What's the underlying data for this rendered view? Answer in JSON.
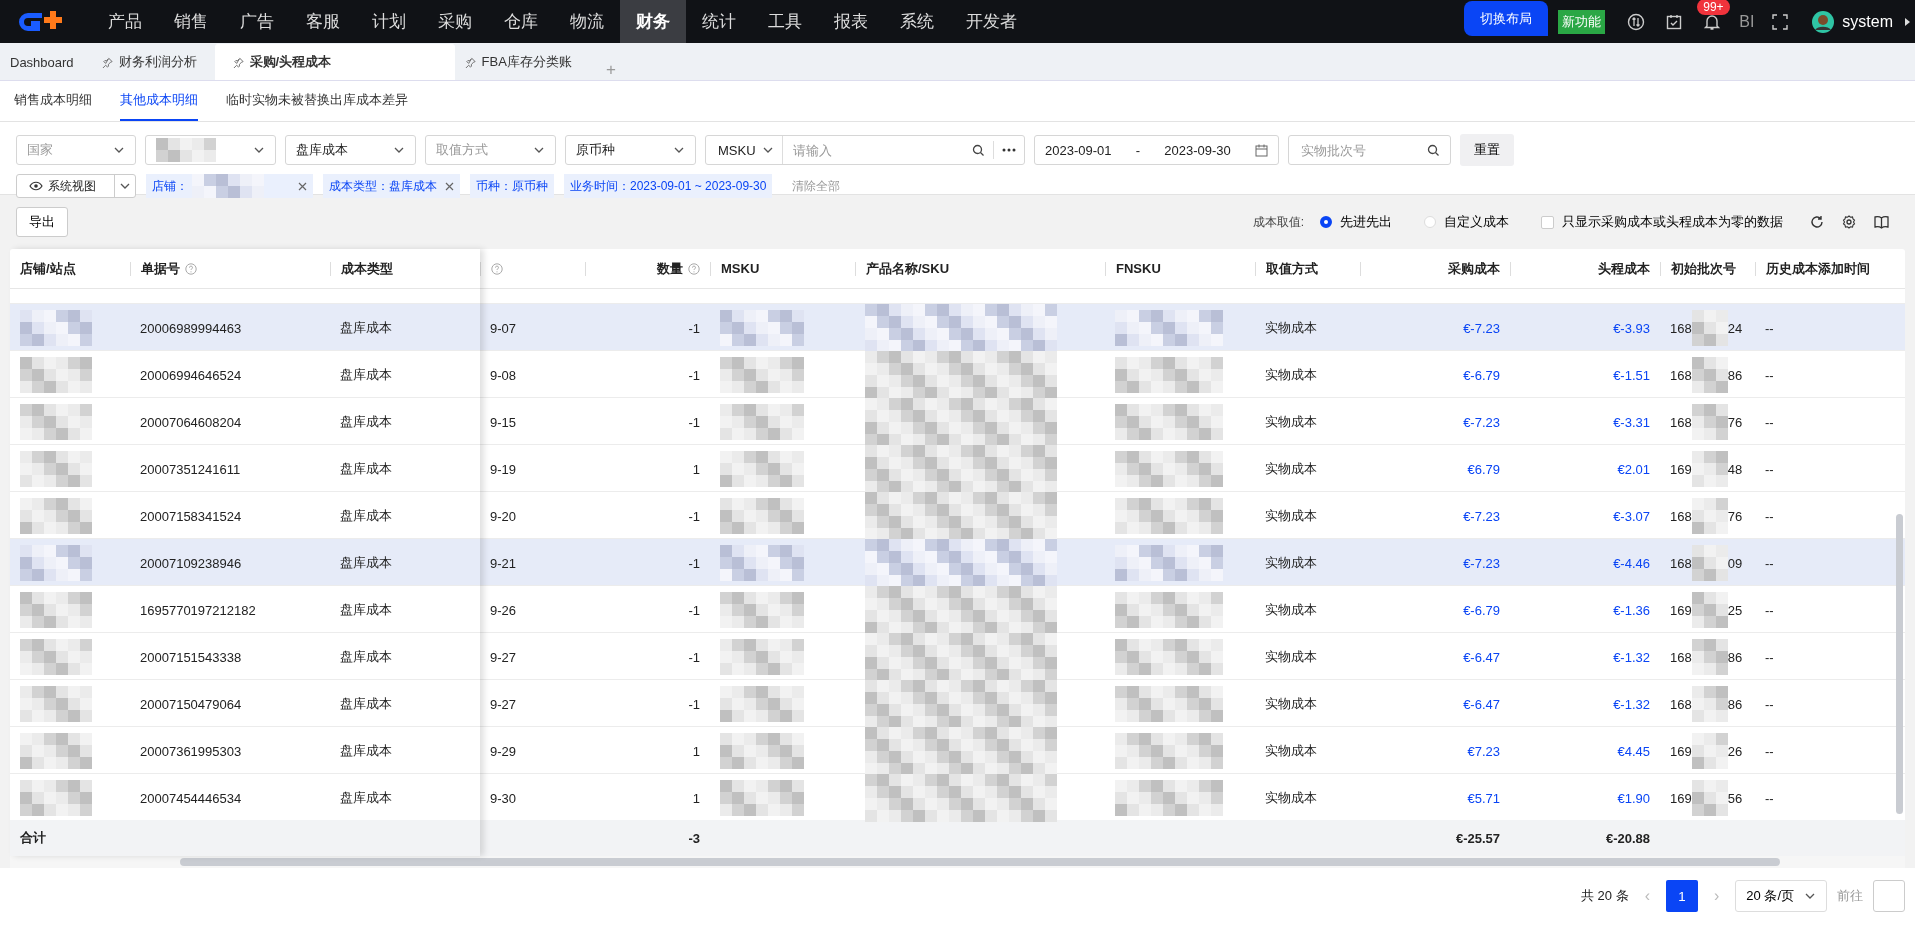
{
  "top_nav": {
    "items": [
      {
        "label": "产品",
        "selected": false
      },
      {
        "label": "销售",
        "selected": false
      },
      {
        "label": "广告",
        "selected": false
      },
      {
        "label": "客服",
        "selected": false
      },
      {
        "label": "计划",
        "selected": false
      },
      {
        "label": "采购",
        "selected": false
      },
      {
        "label": "仓库",
        "selected": false
      },
      {
        "label": "物流",
        "selected": false
      },
      {
        "label": "财务",
        "selected": true
      },
      {
        "label": "统计",
        "selected": false
      },
      {
        "label": "工具",
        "selected": false
      },
      {
        "label": "报表",
        "selected": false
      },
      {
        "label": "系统",
        "selected": false
      },
      {
        "label": "开发者",
        "selected": false
      }
    ],
    "switch_layout": "切换布局",
    "new_feature": "新功能",
    "notification_count": "99+",
    "bi": "BI",
    "user": "system"
  },
  "page_tabs": [
    {
      "label": "Dashboard",
      "pinned": false,
      "selected": false
    },
    {
      "label": "财务利润分析",
      "pinned": true,
      "selected": false
    },
    {
      "label": "采购/头程成本",
      "pinned": true,
      "selected": true
    },
    {
      "label": "FBA库存分类账",
      "pinned": true,
      "selected": false
    }
  ],
  "add_tab": "+",
  "sub_tabs": [
    {
      "label": "销售成本明细",
      "selected": false
    },
    {
      "label": "其他成本明细",
      "selected": true
    },
    {
      "label": "临时实物未被替换出库成本差异",
      "selected": false
    }
  ],
  "filters": {
    "selects": [
      {
        "kind": "placeholder",
        "text": "国家"
      },
      {
        "kind": "redacted"
      },
      {
        "kind": "value",
        "text": "盘库成本"
      },
      {
        "kind": "placeholder",
        "text": "取值方式"
      },
      {
        "kind": "value",
        "text": "原币种"
      }
    ],
    "msku": {
      "field": "MSKU",
      "placeholder": "请输入"
    },
    "date_from": "2023-09-01",
    "date_sep": "-",
    "date_to": "2023-09-30",
    "batch_placeholder": "实物批次号",
    "reset": "重置",
    "view": "系统视图",
    "tags": [
      {
        "label": "店铺：",
        "redacted": true,
        "closable": true
      },
      {
        "label": "成本类型：盘库成本",
        "redacted": false,
        "closable": true
      },
      {
        "label": "币种：原币种",
        "redacted": false,
        "closable": false
      },
      {
        "label": "业务时间：2023-09-01 ~ 2023-09-30",
        "redacted": false,
        "closable": false
      }
    ],
    "clear_all": "清除全部"
  },
  "toolbar": {
    "export": "导出",
    "cost_label": "成本取值:",
    "options": [
      {
        "label": "先进先出",
        "selected": true
      },
      {
        "label": "自定义成本",
        "selected": false
      }
    ],
    "zero_only": {
      "label": "只显示采购成本或头程成本为零的数据",
      "checked": false
    }
  },
  "table": {
    "columns": [
      {
        "label": "店铺/站点",
        "help": false
      },
      {
        "label": "单据号",
        "help": true
      },
      {
        "label": "成本类型",
        "help": false
      },
      {
        "help": true
      },
      {
        "label": "数量",
        "help": true
      },
      {
        "label": "MSKU",
        "help": false
      },
      {
        "label": "产品名称/SKU",
        "help": false
      },
      {
        "label": "FNSKU",
        "help": false
      },
      {
        "label": "取值方式",
        "help": false
      },
      {
        "label": "采购成本",
        "help": false
      },
      {
        "label": "头程成本",
        "help": false
      },
      {
        "label": "初始批次号",
        "help": false
      },
      {
        "label": "历史成本添加时间",
        "help": false
      }
    ],
    "rows": [
      {
        "doc": "20006989994463",
        "type": "盘库成本",
        "date": "9-07",
        "qty": "-1",
        "method": "实物成本",
        "purchase": "€-7.23",
        "freight": "€-3.93",
        "batch_start": "168",
        "batch_end": "24",
        "history": "--",
        "selected": true
      },
      {
        "doc": "20006994646524",
        "type": "盘库成本",
        "date": "9-08",
        "qty": "-1",
        "method": "实物成本",
        "purchase": "€-6.79",
        "freight": "€-1.51",
        "batch_start": "168",
        "batch_end": "86",
        "history": "--",
        "selected": false
      },
      {
        "doc": "20007064608204",
        "type": "盘库成本",
        "date": "9-15",
        "qty": "-1",
        "method": "实物成本",
        "purchase": "€-7.23",
        "freight": "€-3.31",
        "batch_start": "168",
        "batch_end": "76",
        "history": "--",
        "selected": false
      },
      {
        "doc": "20007351241611",
        "type": "盘库成本",
        "date": "9-19",
        "qty": "1",
        "method": "实物成本",
        "purchase": "€6.79",
        "freight": "€2.01",
        "batch_start": "169",
        "batch_end": "48",
        "history": "--",
        "selected": false
      },
      {
        "doc": "20007158341524",
        "type": "盘库成本",
        "date": "9-20",
        "qty": "-1",
        "method": "实物成本",
        "purchase": "€-7.23",
        "freight": "€-3.07",
        "batch_start": "168",
        "batch_end": "76",
        "history": "--",
        "selected": false
      },
      {
        "doc": "20007109238946",
        "type": "盘库成本",
        "date": "9-21",
        "qty": "-1",
        "method": "实物成本",
        "purchase": "€-7.23",
        "freight": "€-4.46",
        "batch_start": "168",
        "batch_end": "09",
        "history": "--",
        "selected": true
      },
      {
        "doc": "1695770197212182",
        "type": "盘库成本",
        "date": "9-26",
        "qty": "-1",
        "method": "实物成本",
        "purchase": "€-6.79",
        "freight": "€-1.36",
        "batch_start": "169",
        "batch_end": "25",
        "history": "--",
        "selected": false
      },
      {
        "doc": "20007151543338",
        "type": "盘库成本",
        "date": "9-27",
        "qty": "-1",
        "method": "实物成本",
        "purchase": "€-6.47",
        "freight": "€-1.32",
        "batch_start": "168",
        "batch_end": "86",
        "history": "--",
        "selected": false
      },
      {
        "doc": "20007150479064",
        "type": "盘库成本",
        "date": "9-27",
        "qty": "-1",
        "method": "实物成本",
        "purchase": "€-6.47",
        "freight": "€-1.32",
        "batch_start": "168",
        "batch_end": "86",
        "history": "--",
        "selected": false
      },
      {
        "doc": "20007361995303",
        "type": "盘库成本",
        "date": "9-29",
        "qty": "1",
        "method": "实物成本",
        "purchase": "€7.23",
        "freight": "€4.45",
        "batch_start": "169",
        "batch_end": "26",
        "history": "--",
        "selected": false
      },
      {
        "doc": "20007454446534",
        "type": "盘库成本",
        "date": "9-30",
        "qty": "1",
        "method": "实物成本",
        "purchase": "€5.71",
        "freight": "€1.90",
        "batch_start": "169",
        "batch_end": "56",
        "history": "--",
        "selected": false
      }
    ],
    "totals": {
      "label": "合计",
      "qty": "-3",
      "purchase": "€-25.57",
      "freight": "€-20.88"
    }
  },
  "pagination": {
    "total": "共 20 条",
    "prev": "‹",
    "pages": [
      {
        "label": "1",
        "selected": true
      }
    ],
    "next": "›",
    "page_size": "20 条/页",
    "goto": "前往"
  }
}
